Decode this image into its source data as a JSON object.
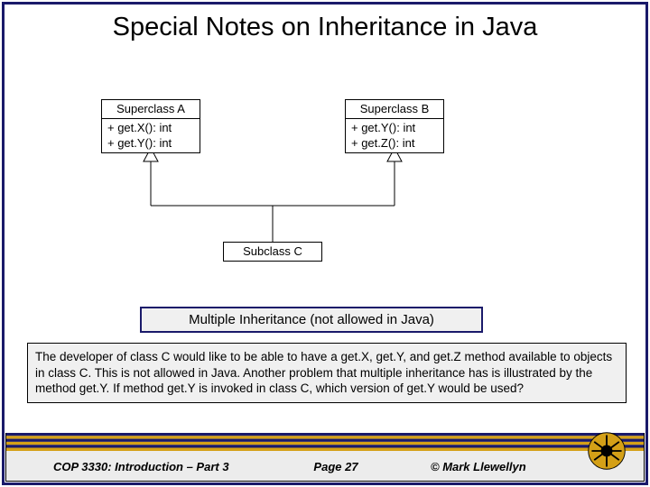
{
  "title": "Special Notes on Inheritance in Java",
  "classA": {
    "name": "Superclass A",
    "m1": "+ get.X(): int",
    "m2": "+ get.Y(): int"
  },
  "classB": {
    "name": "Superclass B",
    "m1": "+ get.Y(): int",
    "m2": "+ get.Z(): int"
  },
  "classC": {
    "name": "Subclass C"
  },
  "caption": "Multiple Inheritance (not allowed in Java)",
  "body": "The developer of class C would like to be able to have a get.X, get.Y, and get.Z method available to objects in class C.  This is not allowed in Java.  Another problem that multiple inheritance has is illustrated by the method get.Y.  If method get.Y is invoked in class C, which version of get.Y would be used?",
  "footer": {
    "course": "COP 3330: Introduction – Part 3",
    "page": "Page 27",
    "copyright": "© Mark Llewellyn"
  },
  "colors": {
    "darkBlue": "#1a1a6a",
    "gold": "#d4a017"
  }
}
